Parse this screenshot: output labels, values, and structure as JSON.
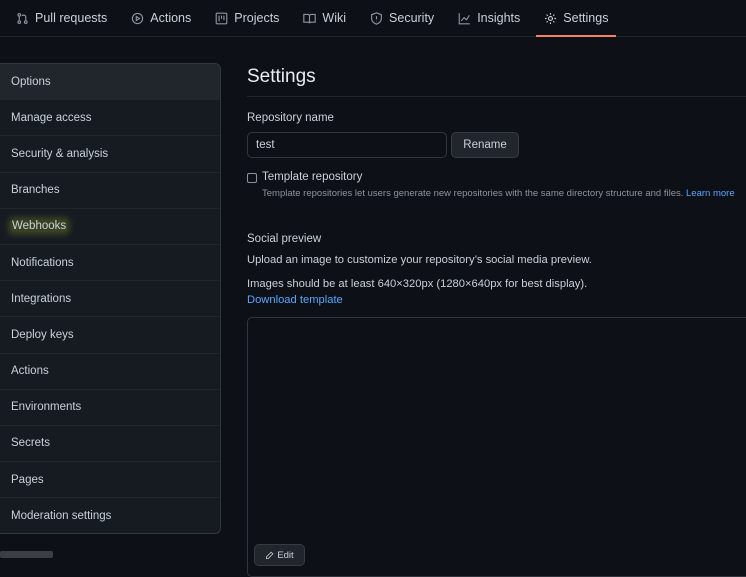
{
  "repo_nav": {
    "tabs": [
      {
        "label": "Pull requests",
        "icon": "git-pull-request-icon"
      },
      {
        "label": "Actions",
        "icon": "play-icon"
      },
      {
        "label": "Projects",
        "icon": "project-icon"
      },
      {
        "label": "Wiki",
        "icon": "book-icon"
      },
      {
        "label": "Security",
        "icon": "shield-icon"
      },
      {
        "label": "Insights",
        "icon": "graph-icon"
      },
      {
        "label": "Settings",
        "icon": "gear-icon",
        "selected": true
      }
    ],
    "selected_underline_color": "#f78166"
  },
  "sidebar": {
    "items": [
      {
        "label": "Options",
        "selected": true
      },
      {
        "label": "Manage access"
      },
      {
        "label": "Security & analysis"
      },
      {
        "label": "Branches"
      },
      {
        "label": "Webhooks",
        "highlighted": true
      },
      {
        "label": "Notifications"
      },
      {
        "label": "Integrations"
      },
      {
        "label": "Deploy keys"
      },
      {
        "label": "Actions"
      },
      {
        "label": "Environments"
      },
      {
        "label": "Secrets"
      },
      {
        "label": "Pages"
      },
      {
        "label": "Moderation settings"
      }
    ]
  },
  "main": {
    "title": "Settings",
    "repository_name_label": "Repository name",
    "repository_name_value": "test",
    "rename_button": "Rename",
    "template_label": "Template repository",
    "template_note": "Template repositories let users generate new repositories with the same directory structure and files.",
    "template_learn_more": "Learn more",
    "social_preview_label": "Social preview",
    "upload_text": "Upload an image to customize your repository’s social media preview.",
    "size_text": "Images should be at least 640×320px (1280×640px for best display).",
    "download_template": "Download template",
    "edit_button": "Edit"
  },
  "colors": {
    "background": "#0d1117",
    "link": "#58a6ff",
    "highlight": "#bbc828"
  }
}
